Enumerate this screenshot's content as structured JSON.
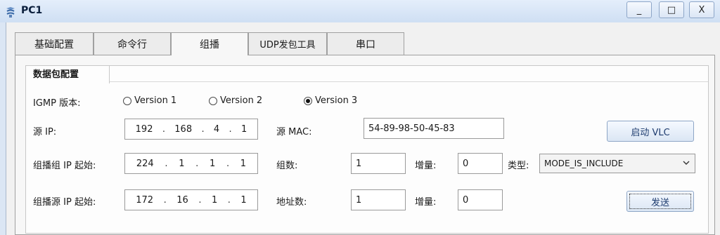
{
  "window": {
    "title": "PC1",
    "minimize_label": "_",
    "maximize_label": "□",
    "close_label": "X"
  },
  "tabs": [
    {
      "label": "基础配置",
      "active": false
    },
    {
      "label": "命令行",
      "active": false
    },
    {
      "label": "组播",
      "active": true
    },
    {
      "label": "UDP发包工具",
      "active": false
    },
    {
      "label": "串口",
      "active": false
    }
  ],
  "packet_config": {
    "group_title": "数据包配置",
    "igmp_label": "IGMP 版本:",
    "versions": [
      {
        "label": "Version 1",
        "checked": false
      },
      {
        "label": "Version 2",
        "checked": false
      },
      {
        "label": "Version 3",
        "checked": true
      }
    ],
    "src_ip_label": "源 IP:",
    "src_ip": [
      "192",
      "168",
      "4",
      "1"
    ],
    "src_mac_label": "源  MAC:",
    "src_mac": "54-89-98-50-45-83",
    "start_vlc_label": "启动 VLC",
    "group_ip_label": "组播组 IP 起始:",
    "group_ip": [
      "224",
      "1",
      "1",
      "1"
    ],
    "group_count_label": "组数:",
    "group_count": "1",
    "increment_label": "增量:",
    "group_increment": "0",
    "type_label": "类型:",
    "type_value": "MODE_IS_INCLUDE",
    "source_ip_label": "组播源 IP 起始:",
    "source_ip": [
      "172",
      "16",
      "1",
      "1"
    ],
    "address_count_label": "地址数:",
    "address_count": "1",
    "source_increment": "0",
    "send_label": "发送"
  }
}
